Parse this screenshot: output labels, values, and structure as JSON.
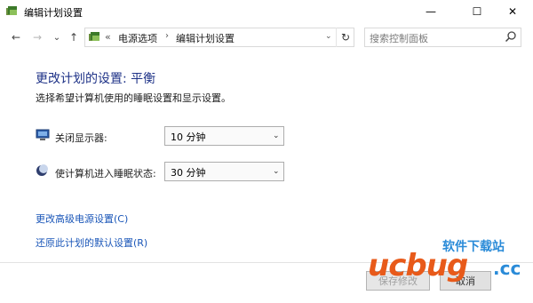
{
  "window": {
    "title": "编辑计划设置",
    "minimize": "—",
    "maximize": "☐",
    "close": "✕"
  },
  "nav": {
    "back": "←",
    "forward": "→",
    "dropdown": "⌄",
    "up": "↑",
    "breadcrumb_prefix": "«",
    "crumbs": [
      "电源选项",
      "编辑计划设置"
    ],
    "separator": "›",
    "refresh": "↻",
    "search_placeholder": "搜索控制面板"
  },
  "content": {
    "heading": "更改计划的设置: 平衡",
    "subtitle": "选择希望计算机使用的睡眠设置和显示设置。",
    "settings": [
      {
        "label": "关闭显示器:",
        "value": "10 分钟",
        "icon": "monitor-icon"
      },
      {
        "label": "使计算机进入睡眠状态:",
        "value": "30 分钟",
        "icon": "moon-icon"
      }
    ],
    "links": [
      "更改高级电源设置(C)",
      "还原此计划的默认设置(R)"
    ]
  },
  "footer": {
    "save": "保存修改",
    "cancel": "取消"
  },
  "watermark": {
    "top_text": "软件下载站",
    "main_text": "ucbug",
    "suffix": ".cc"
  },
  "colors": {
    "heading": "#1e3287",
    "link": "#1a56b8",
    "watermark_orange": "#e85a1a",
    "watermark_blue": "#2a8bd8"
  }
}
